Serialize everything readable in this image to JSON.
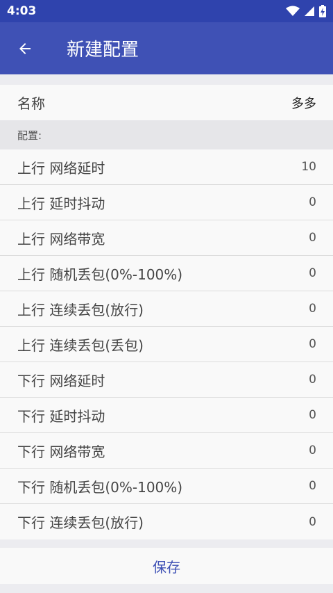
{
  "status_bar": {
    "time": "4:03",
    "icons": [
      "wifi-icon",
      "signal-icon",
      "battery-charging-icon"
    ]
  },
  "app_bar": {
    "title": "新建配置",
    "back_icon": "arrow-left-icon"
  },
  "name_row": {
    "label": "名称",
    "value": "多多"
  },
  "section": {
    "header": "配置:"
  },
  "config_rows": [
    {
      "label": "上行 网络延时",
      "value": "10"
    },
    {
      "label": "上行 延时抖动",
      "value": "0"
    },
    {
      "label": "上行 网络带宽",
      "value": "0"
    },
    {
      "label": "上行 随机丢包(0%-100%)",
      "value": "0"
    },
    {
      "label": "上行 连续丢包(放行)",
      "value": "0"
    },
    {
      "label": "上行 连续丢包(丢包)",
      "value": "0"
    },
    {
      "label": "下行 网络延时",
      "value": "0"
    },
    {
      "label": "下行 延时抖动",
      "value": "0"
    },
    {
      "label": "下行 网络带宽",
      "value": "0"
    },
    {
      "label": "下行 随机丢包(0%-100%)",
      "value": "0"
    },
    {
      "label": "下行 连续丢包(放行)",
      "value": "0"
    }
  ],
  "save_button": {
    "label": "保存"
  },
  "colors": {
    "primary": "#3f51b5",
    "status_bar": "#2f43ad",
    "background": "#ececf0",
    "row_background": "#f9f9f9"
  }
}
